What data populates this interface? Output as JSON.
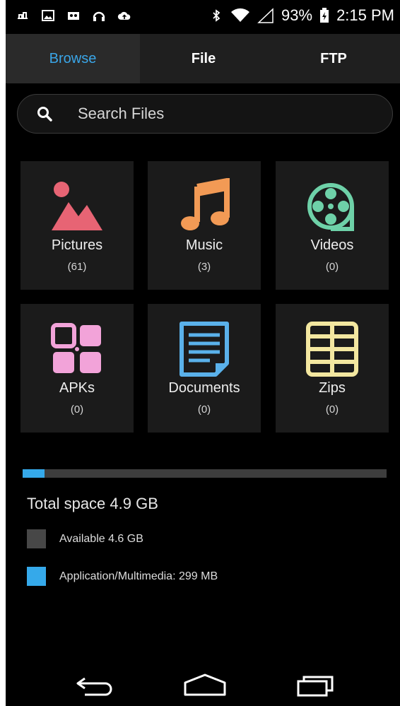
{
  "status_bar": {
    "battery": "93%",
    "time": "2:15 PM",
    "icons": [
      "usb-debug-icon",
      "image-icon",
      "voicemail-icon",
      "headset-icon",
      "cloud-upload-icon",
      "bluetooth-icon",
      "wifi-icon",
      "signal-icon",
      "battery-icon"
    ]
  },
  "tabs": [
    {
      "label": "Browse",
      "active": true
    },
    {
      "label": "File",
      "active": false
    },
    {
      "label": "FTP",
      "active": false
    }
  ],
  "search": {
    "placeholder": "Search Files"
  },
  "categories": [
    {
      "label": "Pictures",
      "count": "(61)",
      "icon": "pictures-icon",
      "color": "#e76474"
    },
    {
      "label": "Music",
      "count": "(3)",
      "icon": "music-icon",
      "color": "#f29a55"
    },
    {
      "label": "Videos",
      "count": "(0)",
      "icon": "videos-icon",
      "color": "#6ed1a8"
    },
    {
      "label": "APKs",
      "count": "(0)",
      "icon": "apks-icon",
      "color": "#f2a3d9"
    },
    {
      "label": "Documents",
      "count": "(0)",
      "icon": "documents-icon",
      "color": "#5ab1ea"
    },
    {
      "label": "Zips",
      "count": "(0)",
      "icon": "zips-icon",
      "color": "#f3e7a0"
    }
  ],
  "storage": {
    "used_fraction": 0.06,
    "total_label": "Total space 4.9 GB",
    "legend": [
      {
        "label": "Available 4.6 GB",
        "color": "#474747"
      },
      {
        "label": "Application/Multimedia: 299 MB",
        "color": "#35a9ea"
      }
    ]
  },
  "nav": {
    "icons": [
      "back-icon",
      "home-icon",
      "recents-icon"
    ]
  }
}
